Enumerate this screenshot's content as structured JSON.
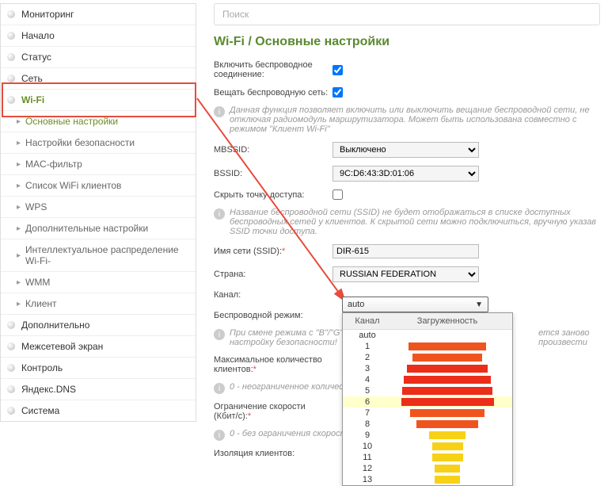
{
  "search": {
    "placeholder": "Поиск"
  },
  "title": "Wi-Fi /  Основные настройки",
  "sidebar": {
    "items": [
      {
        "label": "Мониторинг"
      },
      {
        "label": "Начало"
      },
      {
        "label": "Статус"
      },
      {
        "label": "Сеть"
      },
      {
        "label": "Wi-Fi"
      },
      {
        "label": "Дополнительно"
      },
      {
        "label": "Межсетевой экран"
      },
      {
        "label": "Контроль"
      },
      {
        "label": "Яндекс.DNS"
      },
      {
        "label": "Система"
      }
    ],
    "wifi_sub": [
      {
        "label": "Основные настройки"
      },
      {
        "label": "Настройки безопасности"
      },
      {
        "label": "MAC-фильтр"
      },
      {
        "label": "Список WiFi клиентов"
      },
      {
        "label": "WPS"
      },
      {
        "label": "Дополнительные настройки"
      },
      {
        "label": "Интеллектуальное распределение Wi-Fi-"
      },
      {
        "label": "WMM"
      },
      {
        "label": "Клиент"
      }
    ]
  },
  "form": {
    "enable_label": "Включить беспроводное соединение:",
    "broadcast_label": "Вещать беспроводную сеть:",
    "broadcast_hint": "Данная функция позволяет включить или выключить вещание беспроводной сети, не отключая радиомодуль маршрутизатора. Может быть использована совместно с режимом \"Клиент Wi-Fi\"",
    "mbssid_label": "MBSSID:",
    "mbssid_value": "Выключено",
    "bssid_label": "BSSID:",
    "bssid_value": "9C:D6:43:3D:01:06",
    "hide_ap_label": "Скрыть точку доступа:",
    "hide_ap_hint": "Название беспроводной сети (SSID) не будет отображаться в списке доступных беспроводных сетей у клиентов. К скрытой сети можно подключиться, вручную указав SSID точки доступа.",
    "ssid_label": "Имя сети (SSID):",
    "ssid_value": "DIR-615",
    "country_label": "Страна:",
    "country_value": "RUSSIAN FEDERATION",
    "channel_label": "Канал:",
    "channel_value": "auto",
    "mode_label": "Беспроводной режим:",
    "mode_hint": "При смене режима с \"B\"/\"G\" настройку безопасности!",
    "mode_hint_suffix": "ется заново произвести",
    "max_clients_label": "Максимальное количество клиентов:",
    "max_clients_hint": "0 - неограниченное количест",
    "speed_limit_label": "Ограничение скорости (Кбит/c):",
    "speed_limit_hint": "0 - без ограничения скорост",
    "isolation_label": "Изоляция клиентов:"
  },
  "dropdown": {
    "col1": "Канал",
    "col2": "Загруженность",
    "rows": [
      {
        "ch": "auto",
        "load": 0,
        "color": ""
      },
      {
        "ch": "1",
        "load": 75,
        "color": "#f0541e"
      },
      {
        "ch": "2",
        "load": 68,
        "color": "#f0541e"
      },
      {
        "ch": "3",
        "load": 78,
        "color": "#eb2d1a"
      },
      {
        "ch": "4",
        "load": 85,
        "color": "#eb2d1a"
      },
      {
        "ch": "5",
        "load": 88,
        "color": "#eb2d1a"
      },
      {
        "ch": "6",
        "load": 90,
        "color": "#eb2d1a"
      },
      {
        "ch": "7",
        "load": 72,
        "color": "#f0541e"
      },
      {
        "ch": "8",
        "load": 60,
        "color": "#f0541e"
      },
      {
        "ch": "9",
        "load": 35,
        "color": "#f7d117"
      },
      {
        "ch": "10",
        "load": 30,
        "color": "#f7d117"
      },
      {
        "ch": "11",
        "load": 30,
        "color": "#f7d117"
      },
      {
        "ch": "12",
        "load": 25,
        "color": "#f7d117"
      },
      {
        "ch": "13",
        "load": 25,
        "color": "#f7d117"
      }
    ]
  }
}
